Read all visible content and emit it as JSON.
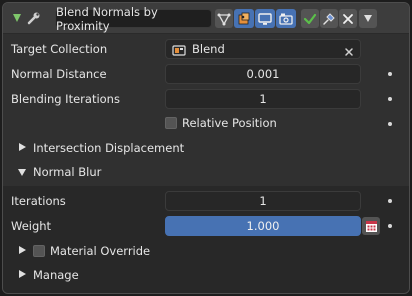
{
  "modifier": {
    "name": "Blend Normals by Proximity",
    "icons": [
      "wrench-icon",
      "vertex-triangle-icon",
      "editmode-icon",
      "realtime-icon",
      "render-icon",
      "apply-check-icon",
      "pin-icon",
      "remove-x-icon",
      "dropdown-icon"
    ]
  },
  "fields": {
    "target_collection_label": "Target Collection",
    "target_collection_value": "Blend",
    "normal_distance_label": "Normal Distance",
    "normal_distance_value": "0.001",
    "blending_iterations_label": "Blending Iterations",
    "blending_iterations_value": "1",
    "relative_position_label": "Relative Position",
    "relative_position_checked": false
  },
  "sections": {
    "intersection_displacement": "Intersection Displacement",
    "normal_blur": "Normal Blur",
    "material_override": "Material Override",
    "manage": "Manage"
  },
  "normal_blur": {
    "iterations_label": "Iterations",
    "iterations_value": "1",
    "weight_label": "Weight",
    "weight_value": "1.000",
    "weight_fill_fraction": 1.0
  },
  "colors": {
    "accent_blue": "#4772b3",
    "panel_bg": "#303030",
    "field_bg": "#272727",
    "green_triangle": "#7fc76b",
    "apply_check": "#5bbf4a"
  }
}
